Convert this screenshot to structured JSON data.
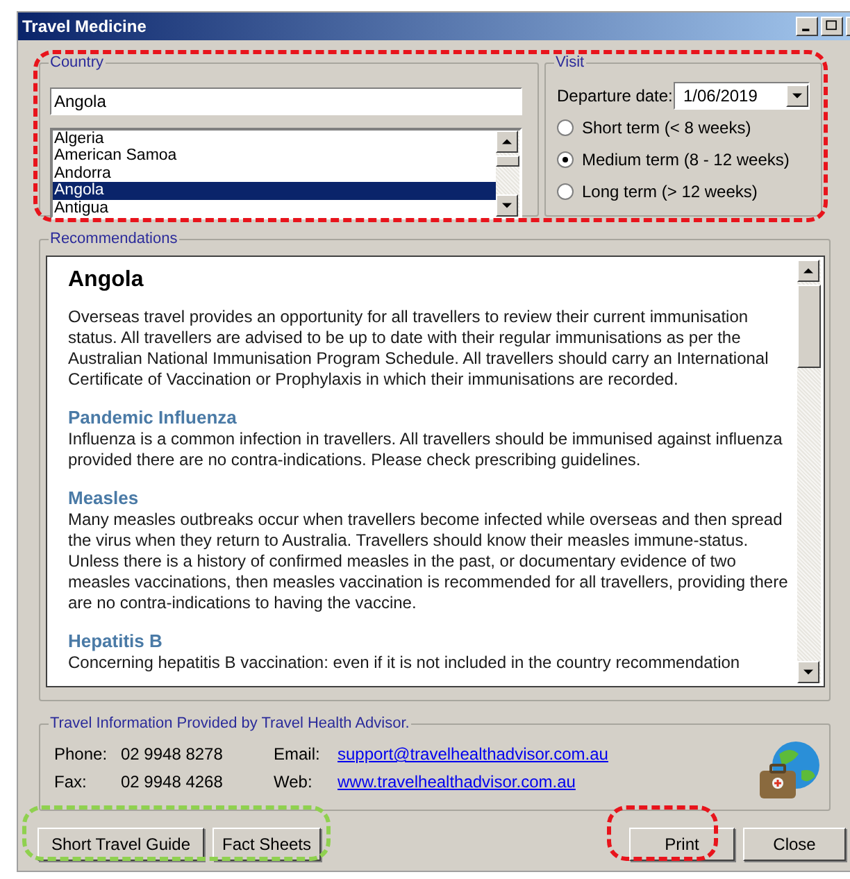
{
  "window": {
    "title": "Travel Medicine"
  },
  "country": {
    "label": "Country",
    "search_value": "Angola",
    "items": [
      {
        "name": "Algeria",
        "selected": false
      },
      {
        "name": "American Samoa",
        "selected": false
      },
      {
        "name": "Andorra",
        "selected": false
      },
      {
        "name": "Angola",
        "selected": true
      },
      {
        "name": "Antigua",
        "selected": false
      }
    ]
  },
  "visit": {
    "label": "Visit",
    "departure_label": "Departure date:",
    "departure_date": "1/06/2019",
    "options": [
      {
        "label": "Short term (< 8 weeks)",
        "selected": false
      },
      {
        "label": "Medium term (8 - 12 weeks)",
        "selected": true
      },
      {
        "label": "Long term (> 12 weeks)",
        "selected": false
      }
    ]
  },
  "recommendations": {
    "label": "Recommendations",
    "title": "Angola",
    "intro": "Overseas travel provides an opportunity for all travellers to review their current immunisation status. All travellers are advised to be up to date with their regular immunisations as per the Australian National Immunisation Program Schedule. All travellers should carry an International Certificate of Vaccination or Prophylaxis in which their immunisations are recorded.",
    "sections": [
      {
        "heading": "Pandemic Influenza",
        "text": "Influenza is a common infection in travellers. All travellers should be immunised against influenza provided there are no contra-indications. Please check prescribing guidelines."
      },
      {
        "heading": "Measles",
        "text": "Many measles outbreaks occur when travellers become infected while overseas and then spread the virus when they return to Australia. Travellers should know their measles immune-status. Unless there is a history of confirmed measles in the past, or documentary evidence of two measles vaccinations, then measles vaccination is recommended for all travellers, providing there are no contra-indications to having the vaccine."
      },
      {
        "heading": "Hepatitis B",
        "text": "Concerning hepatitis B vaccination: even if it is not included in the country recommendation"
      }
    ]
  },
  "provider": {
    "label": "Travel Information Provided by Travel Health Advisor.",
    "contacts": [
      {
        "label": "Phone:",
        "value": "02 9948 8278",
        "kind": "text"
      },
      {
        "label": "Email:",
        "value": "support@travelhealthadvisor.com.au",
        "kind": "link"
      },
      {
        "label": "Fax:",
        "value": "02 9948 4268",
        "kind": "text"
      },
      {
        "label": "Web:",
        "value": "www.travelhealthadvisor.com.au",
        "kind": "link"
      }
    ]
  },
  "buttons_left": [
    "Short Travel Guide",
    "Fact Sheets"
  ],
  "buttons_right": [
    "Print",
    "Close"
  ],
  "highlights": [
    {
      "color": "#e8141c"
    },
    {
      "color": "#8fd14f"
    },
    {
      "color": "#e8141c"
    }
  ]
}
